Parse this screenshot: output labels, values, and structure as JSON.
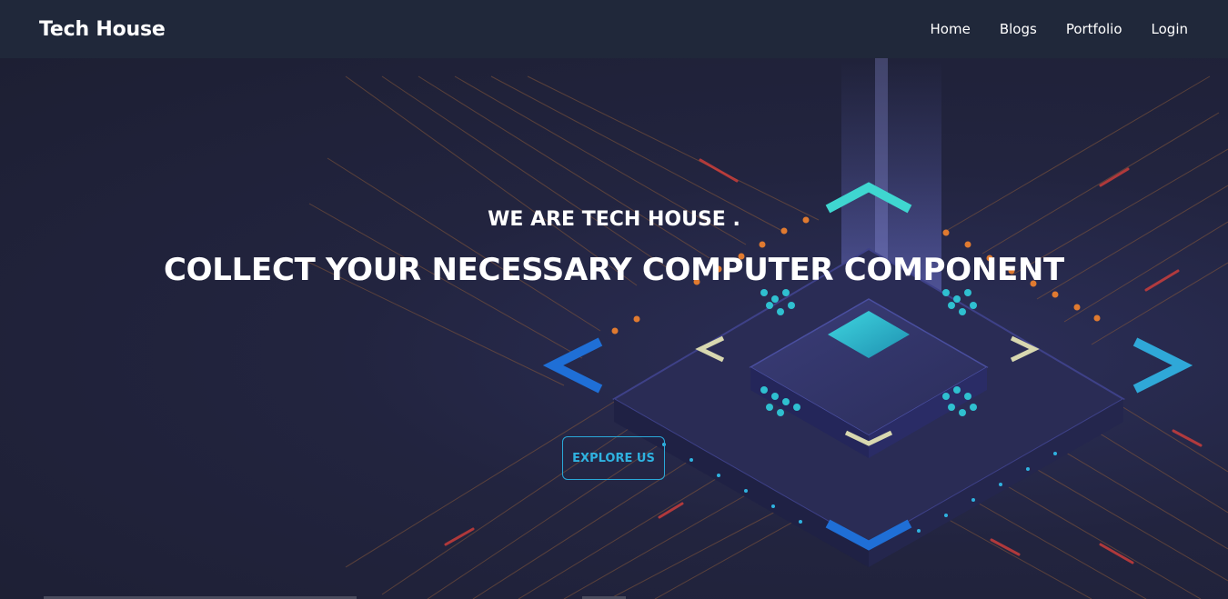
{
  "navbar": {
    "brand": "Tech House",
    "links": [
      "Home",
      "Blogs",
      "Portfolio",
      "Login"
    ]
  },
  "hero": {
    "subtitle": "WE ARE TECH HOUSE .",
    "title": "COLLECT YOUR NECESSARY COMPUTER COMPONENT",
    "cta_label": "EXPLORE US",
    "background_image": "circuit-board-chip-illustration"
  },
  "colors": {
    "navbar_bg": "#20283a",
    "hero_bg": "#1e2136",
    "accent": "#2aa8d8",
    "text": "#ffffff"
  }
}
